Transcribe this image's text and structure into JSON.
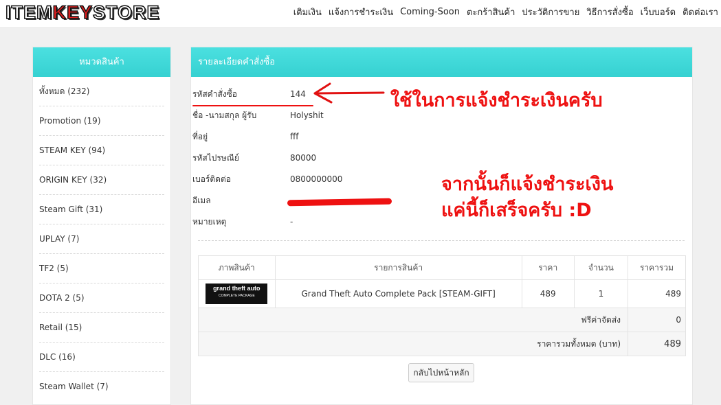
{
  "logo": {
    "part1": "ITEM",
    "part2": "KEY",
    "part3": "STORE"
  },
  "nav": [
    "เติมเงิน",
    "แจ้งการชำระเงิน",
    "Coming-Soon",
    "ตะกร้าสินค้า",
    "ประวัติการขาย",
    "วิธีการสั่งซื้อ",
    "เว็บบอร์ด",
    "ติดต่อเรา"
  ],
  "sidebar": {
    "title": "หมวดสินค้า",
    "items": [
      "ทั้งหมด (232)",
      "Promotion (19)",
      "STEAM KEY (94)",
      "ORIGIN KEY (32)",
      "Steam Gift (31)",
      "UPLAY (7)",
      "TF2 (5)",
      "DOTA 2 (5)",
      "Retail (15)",
      "DLC (16)",
      "Steam Wallet (7)"
    ]
  },
  "order": {
    "title": "รายละเอียดคำสั่งซื้อ",
    "fields": [
      {
        "label": "รหัสคำสั่งซื้อ",
        "value": "144"
      },
      {
        "label": "ชื่อ -นามสกุล ผู้รับ",
        "value": "Holyshit"
      },
      {
        "label": "ที่อยู่",
        "value": "fff"
      },
      {
        "label": "รหัสไปรษณีย์",
        "value": "80000"
      },
      {
        "label": "เบอร์ติดต่อ",
        "value": "0800000000"
      },
      {
        "label": "อีเมล",
        "value": ""
      },
      {
        "label": "หมายเหตุ",
        "value": "-"
      }
    ]
  },
  "table": {
    "headers": [
      "ภาพสินค้า",
      "รายการสินค้า",
      "ราคา",
      "จำนวน",
      "ราคารวม"
    ],
    "rows": [
      {
        "image_text": "grand theft auto",
        "image_subtext": "COMPLETE PACKAGE",
        "name": "Grand Theft Auto Complete Pack [STEAM-GIFT]",
        "price": "489",
        "qty": "1",
        "total": "489"
      }
    ],
    "shipping_label": "ฟรีค่าจัดส่ง",
    "shipping_value": "0",
    "grand_total_label": "ราคารวมทั้งหมด (บาท)",
    "grand_total_value": "489"
  },
  "back_button": "กลับไปหน้าหลัก",
  "annotations": {
    "note1": "ใช้ในการแจ้งชำระเงินครับ",
    "note2_line1": "จากนั้นก็แจ้งชำระเงิน",
    "note2_line2": "แค่นี้ก็เสร็จครับ  :D",
    "color": "#e11111"
  },
  "colors": {
    "header": "#3dd6d6",
    "accent": "#e11111"
  }
}
